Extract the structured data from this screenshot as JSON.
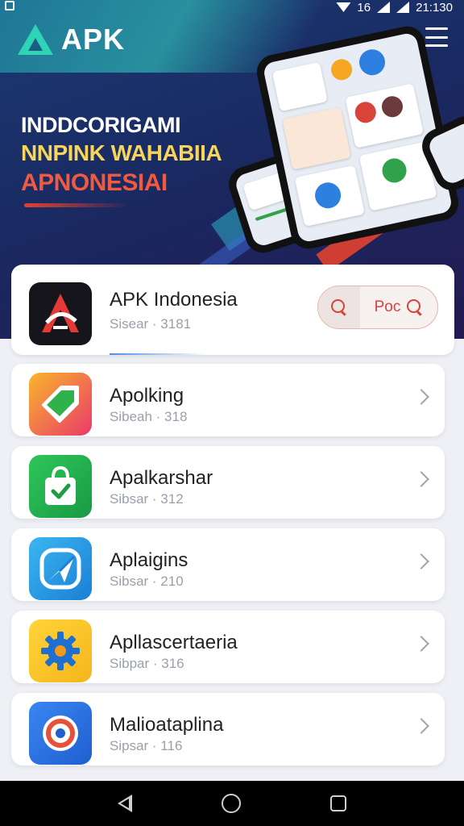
{
  "status_bar": {
    "network": "16",
    "time": "21:130"
  },
  "header": {
    "logo_text": "APK",
    "menu_icon": "hamburger-menu-icon"
  },
  "hero": {
    "line1": "INDDCORIGAMI",
    "line2": "NNPINK WAHABIIA",
    "line3": "APNONESIAI",
    "colors": {
      "line1": "#ffffff",
      "line2": "#f6d55a",
      "line3": "#f05a3e"
    }
  },
  "featured": {
    "title": "APK Indonesia",
    "subtitle": "Sisear · 3181",
    "search_label": "Poc",
    "icon": "apk-indonesia-app-icon"
  },
  "apps": [
    {
      "title": "Apolking",
      "subtitle": "Sibeah · 318",
      "icon": "tag-app-icon",
      "gradient": [
        "#f8b52c",
        "#ea3a6a"
      ]
    },
    {
      "title": "Apalkarshar",
      "subtitle": "Sibsar · 312",
      "icon": "shopping-bag-app-icon",
      "gradient": [
        "#2fc65a",
        "#199a44"
      ]
    },
    {
      "title": "Aplaigins",
      "subtitle": "Sibsar · 210",
      "icon": "send-app-icon",
      "gradient": [
        "#3bb6f0",
        "#1a7fd6"
      ]
    },
    {
      "title": "Apllascertaeria",
      "subtitle": "Sibpar · 316",
      "icon": "gear-app-icon",
      "gradient": [
        "#ffd43a",
        "#f5b51a"
      ]
    },
    {
      "title": "Malioataplina",
      "subtitle": "Sipsar · 116",
      "icon": "target-app-icon",
      "gradient": [
        "#3a86f0",
        "#1f5fd0"
      ]
    }
  ]
}
